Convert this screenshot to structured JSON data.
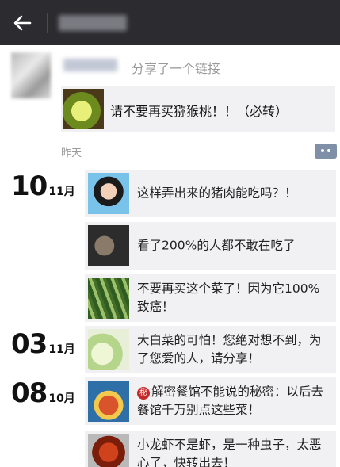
{
  "header": {
    "back_icon": "arrow-left-icon"
  },
  "share": {
    "action_text": "分享了一个链接",
    "link_title": "请不要再买猕猴桃！！（必转）",
    "time_label": "昨天",
    "comment_icon": "comment-dots-icon"
  },
  "posts": [
    {
      "day": "10",
      "month": "11月",
      "items": [
        {
          "text": "这样弄出来的猪肉能吃吗？！"
        },
        {
          "text": "看了200%的人都不敢在吃了"
        },
        {
          "text": "不要再买这个菜了！因为它100%致癌！"
        }
      ]
    },
    {
      "day": "03",
      "month": "11月",
      "items": [
        {
          "text": "大白菜的可怕！您绝对想不到，为了您爱的人，请分享！"
        }
      ]
    },
    {
      "day": "08",
      "month": "10月",
      "items": [
        {
          "badge": "秘",
          "text": "解密餐馆不能说的秘密：以后去餐馆千万别点这些菜！"
        },
        {
          "text": "小龙虾不是虾，是一种虫子，太恶心了，快转出去！"
        }
      ]
    }
  ]
}
